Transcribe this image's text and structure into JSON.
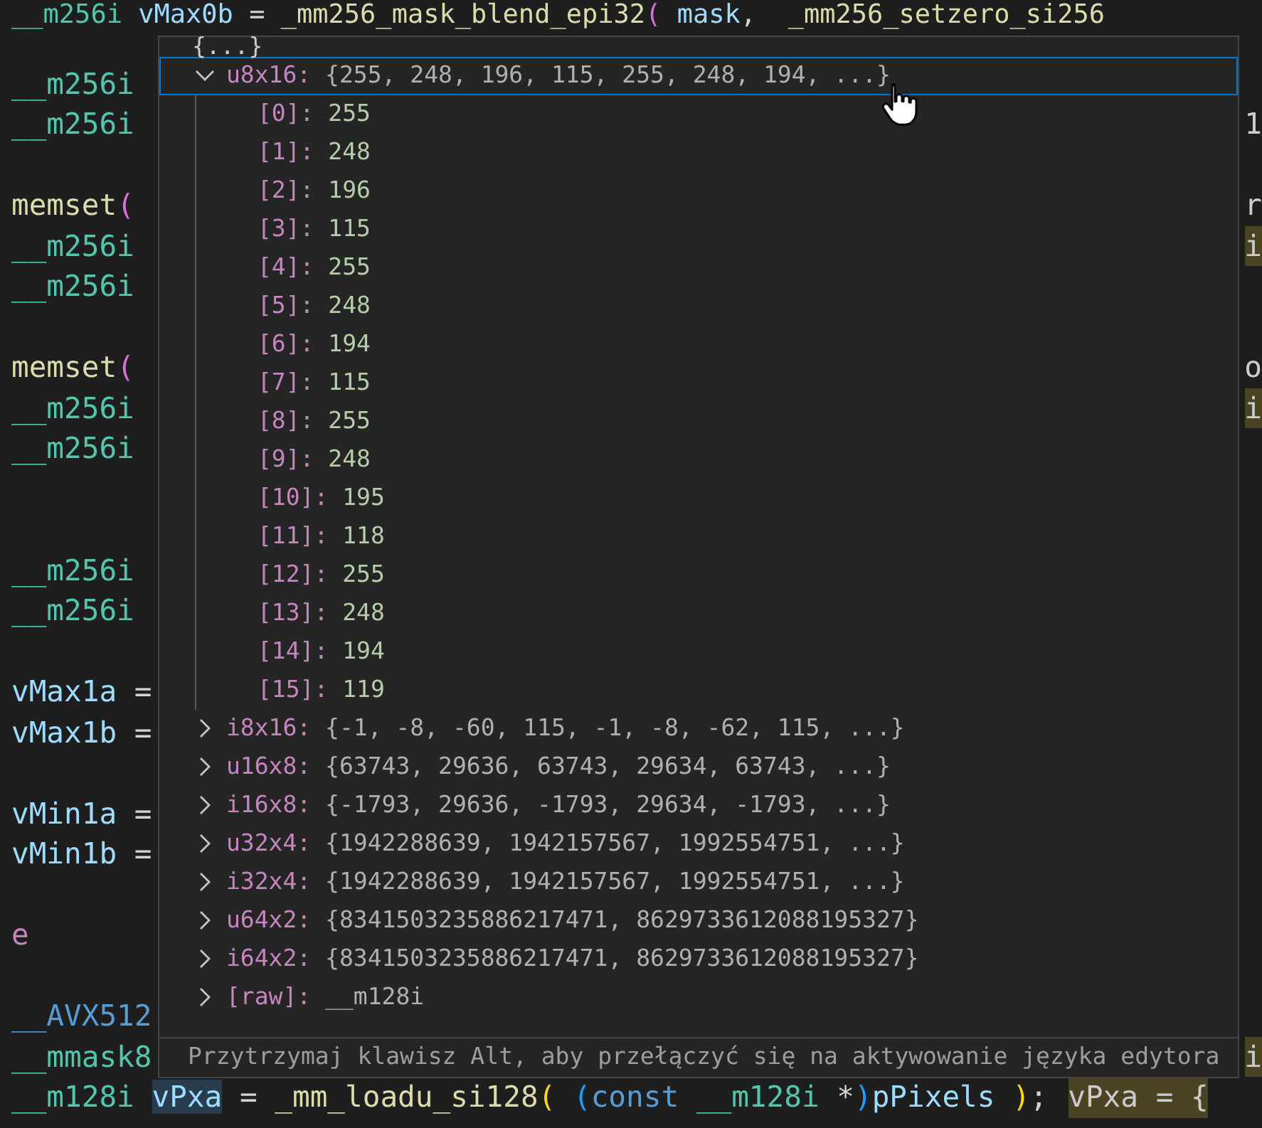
{
  "editor": {
    "lines": [
      {
        "kind": "code",
        "tokens": [
          {
            "text": "__m256i ",
            "kind": "type"
          },
          {
            "text": "vMax0b",
            "kind": "var"
          },
          {
            "text": " = ",
            "kind": "op"
          },
          {
            "text": "_mm256_mask_blend_epi32",
            "kind": "func"
          },
          {
            "text": "( ",
            "kind": "paren2"
          },
          {
            "text": "mask",
            "kind": "var"
          },
          {
            "text": ",  ",
            "kind": "op"
          },
          {
            "text": "_mm256_setzero_si256",
            "kind": "func"
          }
        ]
      },
      {
        "kind": "code",
        "tokens": [
          {
            "text": "__m256i",
            "kind": "type"
          }
        ]
      },
      {
        "kind": "code",
        "tokens": [
          {
            "text": "__m256i",
            "kind": "type"
          }
        ],
        "right": {
          "text": "1",
          "kind": "plain"
        }
      },
      {
        "kind": "blank"
      },
      {
        "kind": "code",
        "tokens": [
          {
            "text": "memset",
            "kind": "func"
          },
          {
            "text": "(",
            "kind": "paren2"
          }
        ],
        "right": {
          "text": "r",
          "kind": "plain"
        }
      },
      {
        "kind": "code",
        "tokens": [
          {
            "text": "__m256i",
            "kind": "type"
          }
        ],
        "right": {
          "text": "i",
          "kind": "hint"
        }
      },
      {
        "kind": "code",
        "tokens": [
          {
            "text": "__m256i",
            "kind": "type"
          }
        ]
      },
      {
        "kind": "blank"
      },
      {
        "kind": "code",
        "tokens": [
          {
            "text": "memset",
            "kind": "func"
          },
          {
            "text": "(",
            "kind": "paren2"
          }
        ],
        "right": {
          "text": "o",
          "kind": "plain"
        }
      },
      {
        "kind": "code",
        "tokens": [
          {
            "text": "__m256i",
            "kind": "type"
          }
        ],
        "right": {
          "text": "i",
          "kind": "hint"
        }
      },
      {
        "kind": "code",
        "tokens": [
          {
            "text": "__m256i",
            "kind": "type"
          }
        ]
      },
      {
        "kind": "blank"
      },
      {
        "kind": "blank"
      },
      {
        "kind": "code",
        "tokens": [
          {
            "text": "__m256i",
            "kind": "type"
          }
        ]
      },
      {
        "kind": "code",
        "tokens": [
          {
            "text": "__m256i",
            "kind": "type"
          }
        ]
      },
      {
        "kind": "blank"
      },
      {
        "kind": "code",
        "tokens": [
          {
            "text": "vMax1a",
            "kind": "var"
          },
          {
            "text": " =",
            "kind": "op"
          }
        ]
      },
      {
        "kind": "code",
        "tokens": [
          {
            "text": "vMax1b",
            "kind": "var"
          },
          {
            "text": " =",
            "kind": "op"
          }
        ]
      },
      {
        "kind": "blank"
      },
      {
        "kind": "code",
        "tokens": [
          {
            "text": "vMin1a",
            "kind": "var"
          },
          {
            "text": " =",
            "kind": "op"
          }
        ]
      },
      {
        "kind": "code",
        "tokens": [
          {
            "text": "vMin1b",
            "kind": "var"
          },
          {
            "text": " =",
            "kind": "op"
          }
        ]
      },
      {
        "kind": "blank"
      },
      {
        "kind": "code",
        "tokens": [
          {
            "text": "e",
            "kind": "control"
          }
        ]
      },
      {
        "kind": "blank"
      },
      {
        "kind": "code",
        "tokens": [
          {
            "text": "__AVX512",
            "kind": "macro"
          }
        ]
      },
      {
        "kind": "code",
        "tokens": [
          {
            "text": "__mmask8",
            "kind": "type"
          }
        ],
        "right": {
          "text": "i",
          "kind": "hint"
        }
      },
      {
        "kind": "code",
        "tokens": [
          {
            "text": "__m128i ",
            "kind": "type"
          },
          {
            "text": "vPxa",
            "kind": "var-highlight"
          },
          {
            "text": " = ",
            "kind": "op"
          },
          {
            "text": "_mm_loadu_si128",
            "kind": "func"
          },
          {
            "text": "( ",
            "kind": "paren1"
          },
          {
            "text": "(",
            "kind": "paren3"
          },
          {
            "text": "const ",
            "kind": "keyword"
          },
          {
            "text": "__m128i ",
            "kind": "type"
          },
          {
            "text": "*",
            "kind": "op"
          },
          {
            "text": ")",
            "kind": "paren3"
          },
          {
            "text": "pPixels ",
            "kind": "var"
          },
          {
            "text": ")",
            "kind": "paren1"
          },
          {
            "text": "; ",
            "kind": "op"
          }
        ],
        "hint": "vPxa = {"
      }
    ]
  },
  "hover": {
    "summary": "{...}",
    "items": [
      {
        "name": "u8x16:",
        "value": "{255, 248, 196, 115, 255, 248, 194, ...}",
        "expanded": true,
        "selected": true,
        "children": [
          {
            "name": "[0]:",
            "value": "255",
            "selected": false
          },
          {
            "name": "[1]:",
            "value": "248",
            "selected": false
          },
          {
            "name": "[2]:",
            "value": "196",
            "selected": false
          },
          {
            "name": "[3]:",
            "value": "115",
            "selected": false
          },
          {
            "name": "[4]:",
            "value": "255",
            "selected": false
          },
          {
            "name": "[5]:",
            "value": "248",
            "selected": false
          },
          {
            "name": "[6]:",
            "value": "194",
            "selected": false
          },
          {
            "name": "[7]:",
            "value": "115",
            "selected": false
          },
          {
            "name": "[8]:",
            "value": "255",
            "selected": false
          },
          {
            "name": "[9]:",
            "value": "248",
            "selected": false
          },
          {
            "name": "[10]:",
            "value": "195",
            "selected": false
          },
          {
            "name": "[11]:",
            "value": "118",
            "selected": false
          },
          {
            "name": "[12]:",
            "value": "255",
            "selected": false
          },
          {
            "name": "[13]:",
            "value": "248",
            "selected": false
          },
          {
            "name": "[14]:",
            "value": "194",
            "selected": false
          },
          {
            "name": "[15]:",
            "value": "119",
            "selected": false
          }
        ]
      },
      {
        "name": "i8x16:",
        "value": "{-1, -8, -60, 115, -1, -8, -62, 115, ...}",
        "expanded": false,
        "selected": false
      },
      {
        "name": "u16x8:",
        "value": "{63743, 29636, 63743, 29634, 63743, ...}",
        "expanded": false,
        "selected": false
      },
      {
        "name": "i16x8:",
        "value": "{-1793, 29636, -1793, 29634, -1793, ...}",
        "expanded": false,
        "selected": false
      },
      {
        "name": "u32x4:",
        "value": "{1942288639, 1942157567, 1992554751, ...}",
        "expanded": false,
        "selected": false
      },
      {
        "name": "i32x4:",
        "value": "{1942288639, 1942157567, 1992554751, ...}",
        "expanded": false,
        "selected": false
      },
      {
        "name": "u64x2:",
        "value": "{8341503235886217471, 8629733612088195327}",
        "expanded": false,
        "selected": false
      },
      {
        "name": "i64x2:",
        "value": "{8341503235886217471, 8629733612088195327}",
        "expanded": false,
        "selected": false
      },
      {
        "name": "[raw]:",
        "value": "__m128i",
        "expanded": false,
        "selected": false
      }
    ],
    "footer": "Przytrzymaj klawisz Alt, aby przełączyć się na aktywowanie języka edytora"
  }
}
